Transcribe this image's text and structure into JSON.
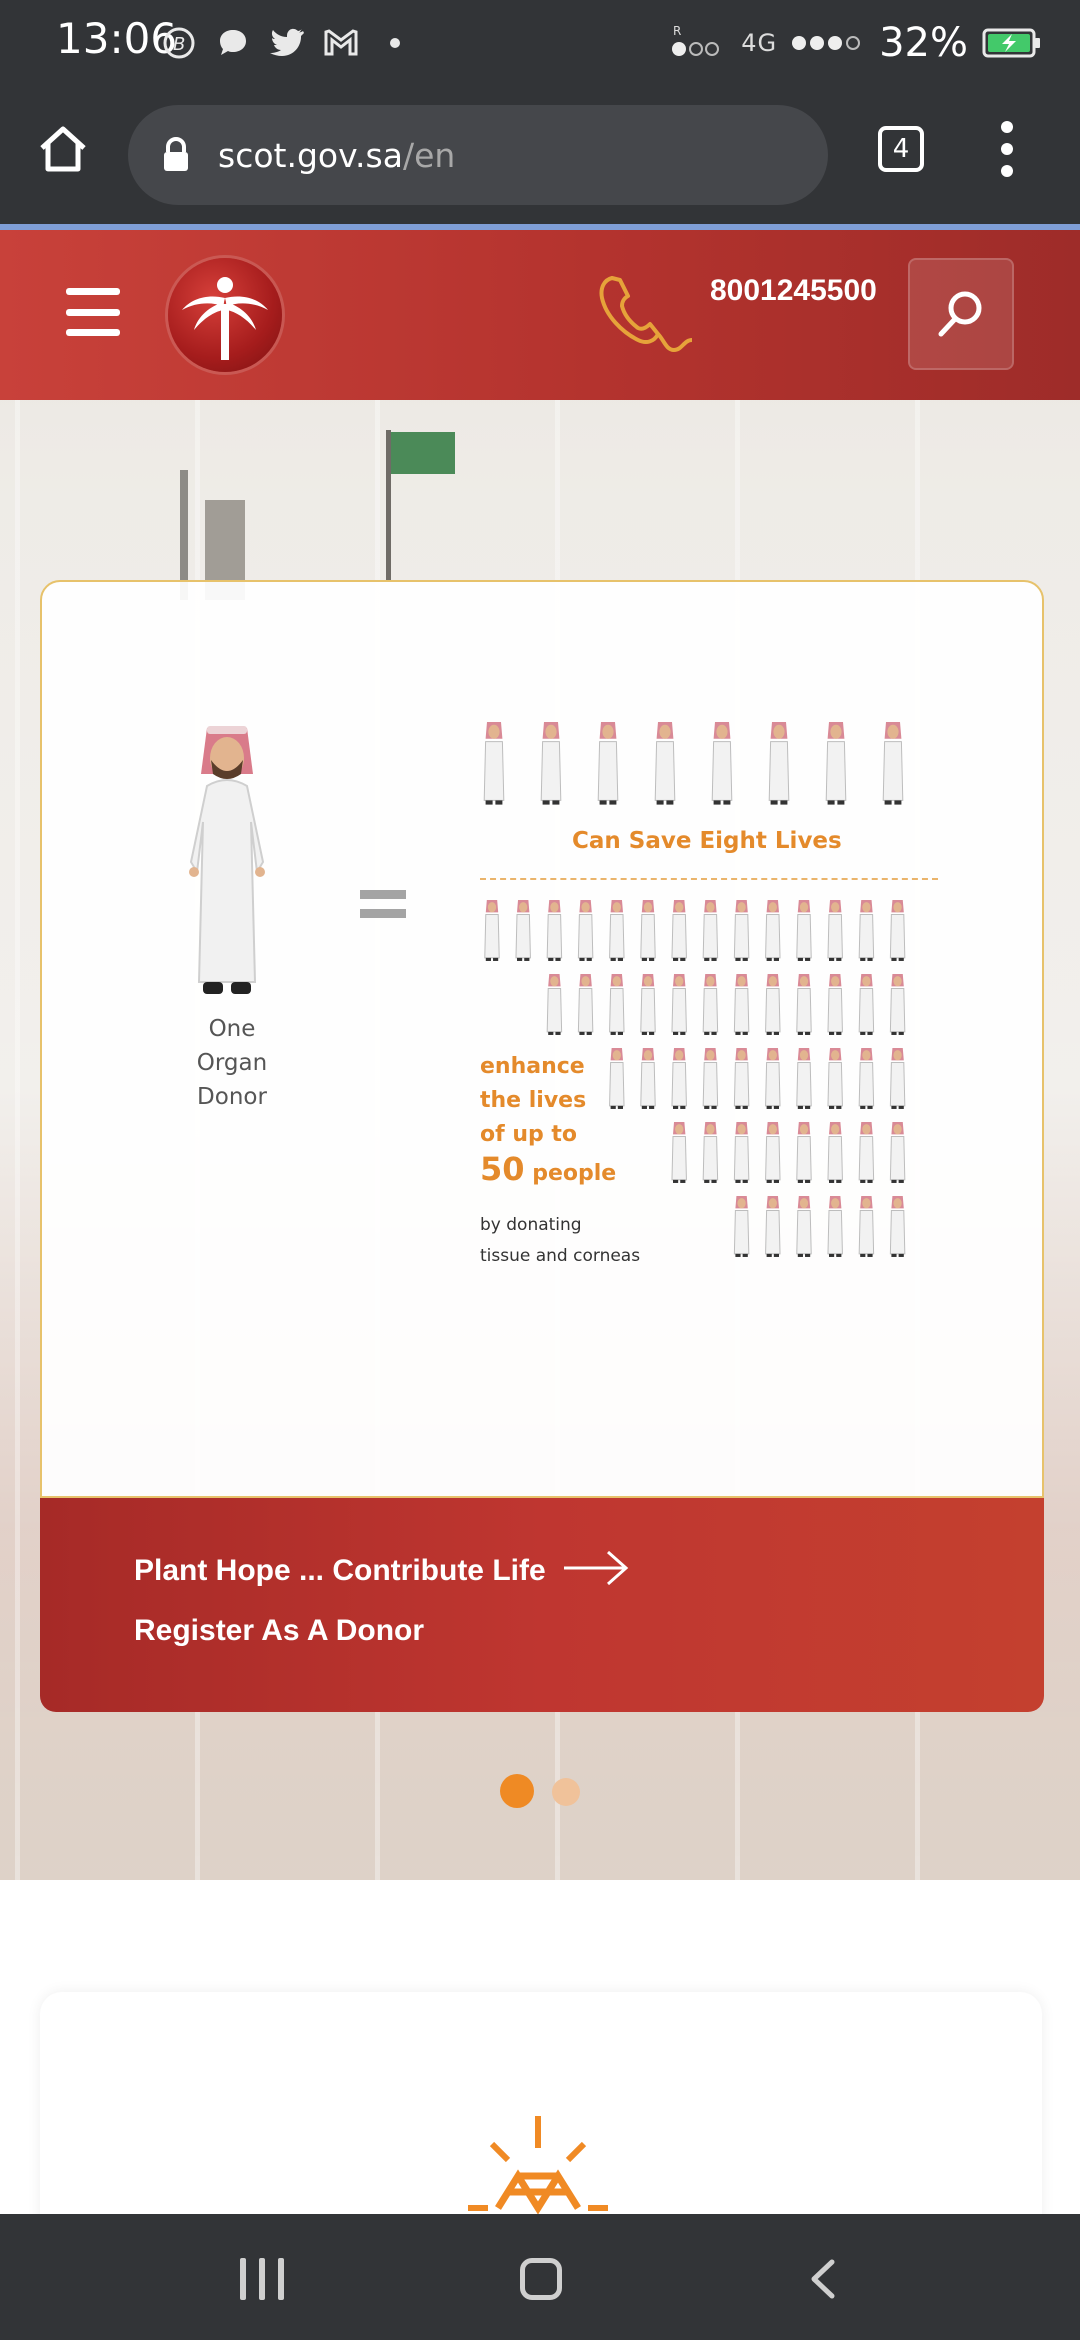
{
  "status_bar": {
    "time": "13:06",
    "network": "4G",
    "battery": "32%"
  },
  "browser": {
    "url_host": "scot.gov.sa",
    "url_path": "/en",
    "tab_count": "4"
  },
  "header": {
    "phone": "8001245500"
  },
  "infographic": {
    "donor_label": [
      "One",
      "Organ",
      "Donor"
    ],
    "save_text": "Can Save Eight Lives",
    "enhance_lines": [
      "enhance",
      "the lives",
      "of up to"
    ],
    "number": "50",
    "people": "people",
    "tissue_lines": [
      "by donating",
      "tissue and corneas"
    ]
  },
  "promo": {
    "line1": "Plant Hope ... Contribute Life",
    "line2": "Register As A Donor"
  },
  "carousel": {
    "slide_count": 2,
    "active_index": 0
  },
  "colors": {
    "brand_red": "#b4332e",
    "accent_orange": "#e48a2b",
    "system_dark": "#323437"
  }
}
